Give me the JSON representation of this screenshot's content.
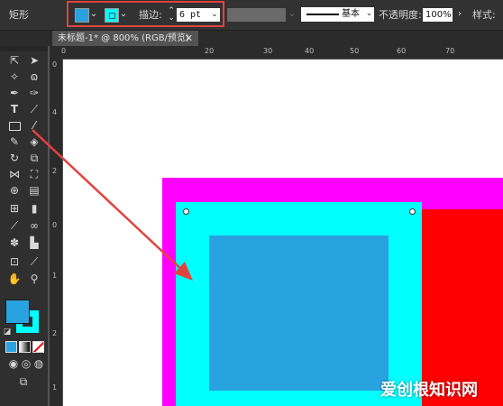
{
  "control_bar": {
    "shape_label": "矩形",
    "fill_color": "#29a3e0",
    "stroke_color": "#00ffff",
    "stroke_label": "描边:",
    "stroke_weight": "6 pt",
    "brush_label": "基本",
    "opacity_label": "不透明度:",
    "opacity_value": "100%",
    "style_label": "样式:"
  },
  "document_tab": {
    "title": "未标题-1* @ 800% (RGB/预览)",
    "close_glyph": "✕"
  },
  "ruler": {
    "top_labels": [
      "0",
      "20",
      "30",
      "40",
      "50",
      "60",
      "70"
    ],
    "left_labels": [
      "0",
      "4",
      "2",
      "0",
      "1",
      "2",
      "1"
    ]
  },
  "swatches": {
    "fill": "#29a3e0",
    "stroke": "#00ffff"
  },
  "artwork": {
    "outer_color": "#ff00ff",
    "stroke_color": "#00ffff",
    "inner_color": "#29a3e0",
    "side_color": "#ff0000"
  },
  "annotation": {
    "arrow_color": "#e2433f"
  },
  "watermark": "爱创根知识网"
}
